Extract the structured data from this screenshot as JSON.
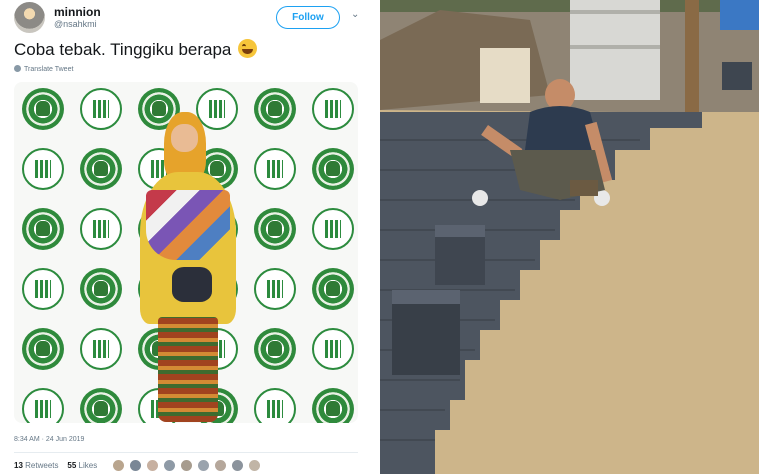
{
  "tweet": {
    "display_name": "minnion",
    "handle": "@nsahkmi",
    "follow_label": "Follow",
    "menu_icon": "chevron-down-icon",
    "text": "Coba tebak. Tinggiku berapa",
    "emoji": "laughing-tears-emoji",
    "translate_label": "Translate Tweet",
    "timestamp": "8:34 AM · 24 Jun 2019",
    "retweets_count": "13",
    "retweets_label": "Retweets",
    "likes_count": "55",
    "likes_label": "Likes"
  },
  "colors": {
    "accent": "#1da1f2",
    "banner_green": "#2f8a3c",
    "paver": "#4d5560",
    "sand": "#cdb58a"
  }
}
